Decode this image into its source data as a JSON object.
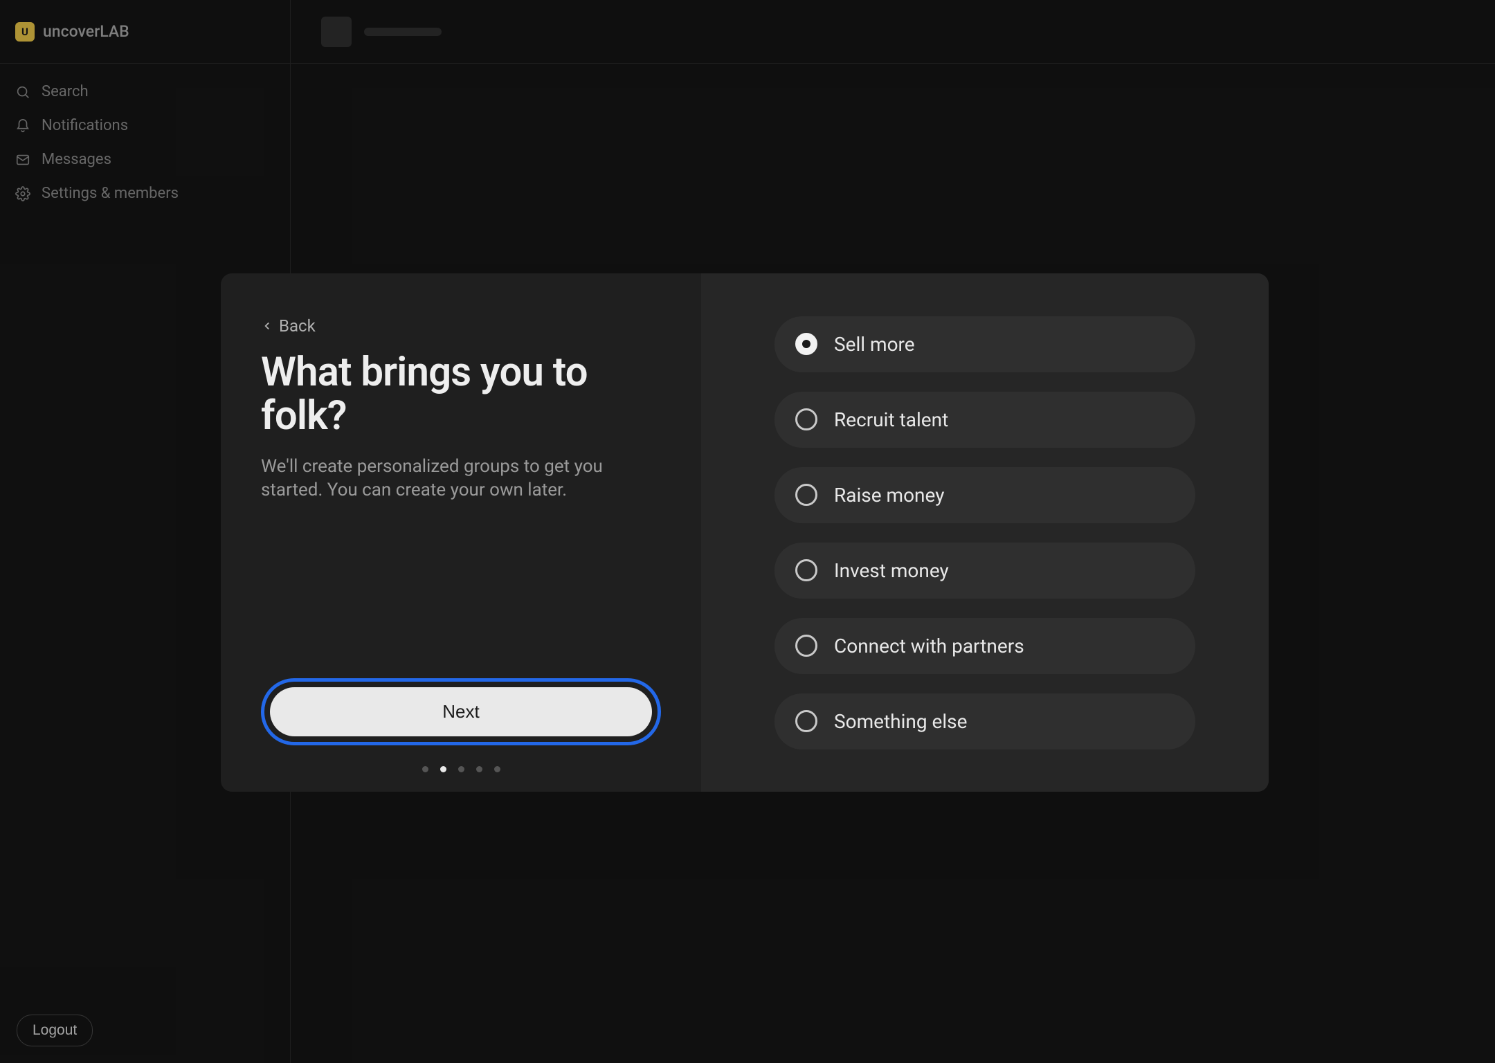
{
  "brand": {
    "badge_letter": "U",
    "name": "uncoverLAB"
  },
  "sidebar": {
    "items": [
      {
        "label": "Search"
      },
      {
        "label": "Notifications"
      },
      {
        "label": "Messages"
      },
      {
        "label": "Settings & members"
      }
    ],
    "logout_label": "Logout"
  },
  "modal": {
    "back_label": "Back",
    "title": "What brings you to folk?",
    "subtitle": "We'll create personalized groups to get you started. You can create your own later.",
    "next_label": "Next",
    "step_count": 5,
    "active_step_index": 1,
    "options": [
      {
        "label": "Sell more",
        "selected": true
      },
      {
        "label": "Recruit talent",
        "selected": false
      },
      {
        "label": "Raise money",
        "selected": false
      },
      {
        "label": "Invest money",
        "selected": false
      },
      {
        "label": "Connect with partners",
        "selected": false
      },
      {
        "label": "Something else",
        "selected": false
      }
    ]
  }
}
